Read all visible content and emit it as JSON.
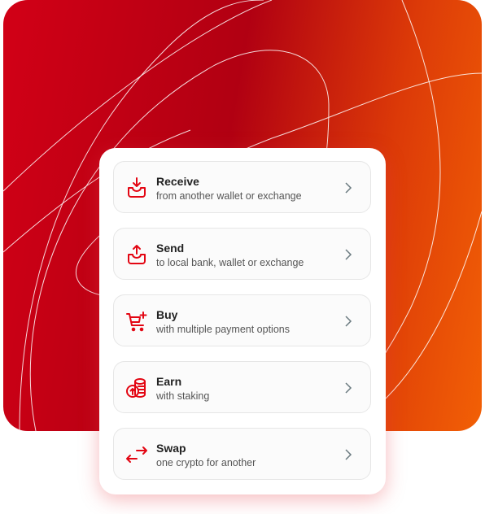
{
  "colors": {
    "accent": "#e30613",
    "chevron": "#6b7b80"
  },
  "actions": [
    {
      "title": "Receive",
      "subtitle": "from another wallet or exchange",
      "icon": "inbox-download-icon"
    },
    {
      "title": "Send",
      "subtitle": "to local bank, wallet or exchange",
      "icon": "inbox-upload-icon"
    },
    {
      "title": "Buy",
      "subtitle": "with multiple payment options",
      "icon": "cart-plus-icon"
    },
    {
      "title": "Earn",
      "subtitle": "with staking",
      "icon": "coins-stack-icon"
    },
    {
      "title": "Swap",
      "subtitle": "one crypto for another",
      "icon": "swap-arrows-icon"
    }
  ]
}
